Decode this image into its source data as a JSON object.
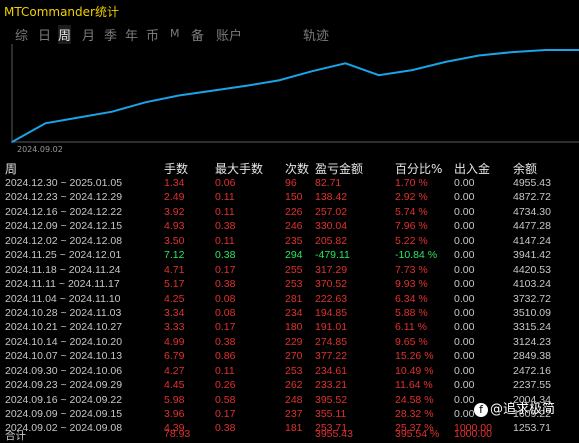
{
  "window": {
    "title": "MTCommander统计"
  },
  "tabs": [
    {
      "label": "综"
    },
    {
      "label": "日"
    },
    {
      "label": "周"
    },
    {
      "label": "月"
    },
    {
      "label": "季"
    },
    {
      "label": "年"
    },
    {
      "label": "币"
    },
    {
      "label": "M"
    },
    {
      "label": "备"
    },
    {
      "label": "账户"
    },
    {
      "label": "轨迹"
    }
  ],
  "active_tab": "周",
  "chart": {
    "start_label": "2024.09.02",
    "line_color": "#1aa3e8"
  },
  "chart_data": {
    "type": "line",
    "x": [
      "2024.09.02",
      "2024.09.09",
      "2024.09.16",
      "2024.09.23",
      "2024.09.30",
      "2024.10.07",
      "2024.10.14",
      "2024.10.21",
      "2024.10.28",
      "2024.11.04",
      "2024.11.11",
      "2024.11.18",
      "2024.11.25",
      "2024.12.02",
      "2024.12.09",
      "2024.12.16",
      "2024.12.23",
      "2024.12.30"
    ],
    "values": [
      1253.71,
      2004.34,
      2237.55,
      2472.16,
      2849.38,
      3124.23,
      3315.24,
      3510.09,
      3732.72,
      4103.24,
      4420.53,
      3941.42,
      4147.24,
      4477.28,
      4734.3,
      4872.72,
      4955.43,
      4955.43
    ],
    "title": "",
    "xlabel": "",
    "ylabel": ""
  },
  "table": {
    "headers": [
      "周",
      "手数",
      "最大手数",
      "次数",
      "盈亏金额",
      "百分比%",
      "出入金",
      "余额"
    ],
    "rows": [
      {
        "period": "2024.12.30 ~ 2025.01.05",
        "lots": "1.34",
        "max_lots": "0.06",
        "count": "96",
        "pnl": "82.71",
        "pct": "1.70 %",
        "flow": "0.00",
        "balance": "4955.43",
        "tone": "red"
      },
      {
        "period": "2024.12.23 ~ 2024.12.29",
        "lots": "2.49",
        "max_lots": "0.11",
        "count": "150",
        "pnl": "138.42",
        "pct": "2.92 %",
        "flow": "0.00",
        "balance": "4872.72",
        "tone": "red"
      },
      {
        "period": "2024.12.16 ~ 2024.12.22",
        "lots": "3.92",
        "max_lots": "0.11",
        "count": "226",
        "pnl": "257.02",
        "pct": "5.74 %",
        "flow": "0.00",
        "balance": "4734.30",
        "tone": "red"
      },
      {
        "period": "2024.12.09 ~ 2024.12.15",
        "lots": "4.93",
        "max_lots": "0.38",
        "count": "246",
        "pnl": "330.04",
        "pct": "7.96 %",
        "flow": "0.00",
        "balance": "4477.28",
        "tone": "red"
      },
      {
        "period": "2024.12.02 ~ 2024.12.08",
        "lots": "3.50",
        "max_lots": "0.11",
        "count": "235",
        "pnl": "205.82",
        "pct": "5.22 %",
        "flow": "0.00",
        "balance": "4147.24",
        "tone": "red"
      },
      {
        "period": "2024.11.25 ~ 2024.12.01",
        "lots": "7.12",
        "max_lots": "0.38",
        "count": "294",
        "pnl": "-479.11",
        "pct": "-10.84 %",
        "flow": "0.00",
        "balance": "3941.42",
        "tone": "green"
      },
      {
        "period": "2024.11.18 ~ 2024.11.24",
        "lots": "4.71",
        "max_lots": "0.17",
        "count": "255",
        "pnl": "317.29",
        "pct": "7.73 %",
        "flow": "0.00",
        "balance": "4420.53",
        "tone": "red"
      },
      {
        "period": "2024.11.11 ~ 2024.11.17",
        "lots": "5.17",
        "max_lots": "0.38",
        "count": "253",
        "pnl": "370.52",
        "pct": "9.93 %",
        "flow": "0.00",
        "balance": "4103.24",
        "tone": "red"
      },
      {
        "period": "2024.11.04 ~ 2024.11.10",
        "lots": "4.25",
        "max_lots": "0.08",
        "count": "281",
        "pnl": "222.63",
        "pct": "6.34 %",
        "flow": "0.00",
        "balance": "3732.72",
        "tone": "red"
      },
      {
        "period": "2024.10.28 ~ 2024.11.03",
        "lots": "3.34",
        "max_lots": "0.08",
        "count": "234",
        "pnl": "194.85",
        "pct": "5.88 %",
        "flow": "0.00",
        "balance": "3510.09",
        "tone": "red"
      },
      {
        "period": "2024.10.21 ~ 2024.10.27",
        "lots": "3.33",
        "max_lots": "0.17",
        "count": "180",
        "pnl": "191.01",
        "pct": "6.11 %",
        "flow": "0.00",
        "balance": "3315.24",
        "tone": "red"
      },
      {
        "period": "2024.10.14 ~ 2024.10.20",
        "lots": "4.99",
        "max_lots": "0.38",
        "count": "229",
        "pnl": "274.85",
        "pct": "9.65 %",
        "flow": "0.00",
        "balance": "3124.23",
        "tone": "red"
      },
      {
        "period": "2024.10.07 ~ 2024.10.13",
        "lots": "6.79",
        "max_lots": "0.86",
        "count": "270",
        "pnl": "377.22",
        "pct": "15.26 %",
        "flow": "0.00",
        "balance": "2849.38",
        "tone": "red"
      },
      {
        "period": "2024.09.30 ~ 2024.10.06",
        "lots": "4.27",
        "max_lots": "0.11",
        "count": "253",
        "pnl": "234.61",
        "pct": "10.49 %",
        "flow": "0.00",
        "balance": "2472.16",
        "tone": "red"
      },
      {
        "period": "2024.09.23 ~ 2024.09.29",
        "lots": "4.45",
        "max_lots": "0.26",
        "count": "262",
        "pnl": "233.21",
        "pct": "11.64 %",
        "flow": "0.00",
        "balance": "2237.55",
        "tone": "red"
      },
      {
        "period": "2024.09.16 ~ 2024.09.22",
        "lots": "5.98",
        "max_lots": "0.58",
        "count": "248",
        "pnl": "395.52",
        "pct": "24.58 %",
        "flow": "0.00",
        "balance": "2004.34",
        "tone": "red"
      },
      {
        "period": "2024.09.09 ~ 2024.09.15",
        "lots": "3.96",
        "max_lots": "0.17",
        "count": "237",
        "pnl": "355.11",
        "pct": "28.32 %",
        "flow": "0.00",
        "balance": "1609.22",
        "tone": "red"
      },
      {
        "period": "2024.09.02 ~ 2024.09.08",
        "lots": "4.39",
        "max_lots": "0.38",
        "count": "181",
        "pnl": "253.71",
        "pct": "25.37 %",
        "flow": "1000.00",
        "balance": "1253.71",
        "tone": "red"
      }
    ],
    "total": {
      "label": "合计",
      "lots": "78.93",
      "pnl": "3955.43",
      "pct": "395.54 %",
      "flow": "1000.00"
    }
  },
  "watermark": {
    "text": "@追求极简"
  },
  "colors": {
    "red": "#e0312f",
    "green": "#27e85f",
    "title": "#f0d000"
  }
}
